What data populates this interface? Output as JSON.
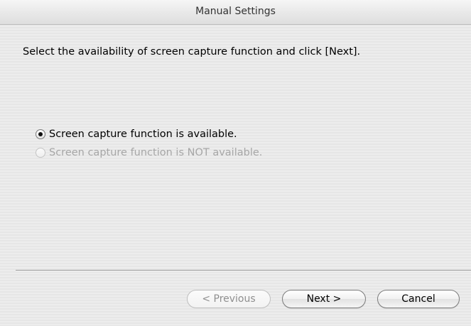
{
  "window": {
    "title": "Manual Settings"
  },
  "main": {
    "instruction": "Select the availability of screen capture function and click [Next].",
    "options": [
      {
        "label": "Screen capture function is available.",
        "selected": true,
        "enabled": true
      },
      {
        "label": "Screen capture function is NOT available.",
        "selected": false,
        "enabled": false
      }
    ]
  },
  "buttons": {
    "previous": "< Previous",
    "next": "Next >",
    "cancel": "Cancel"
  }
}
